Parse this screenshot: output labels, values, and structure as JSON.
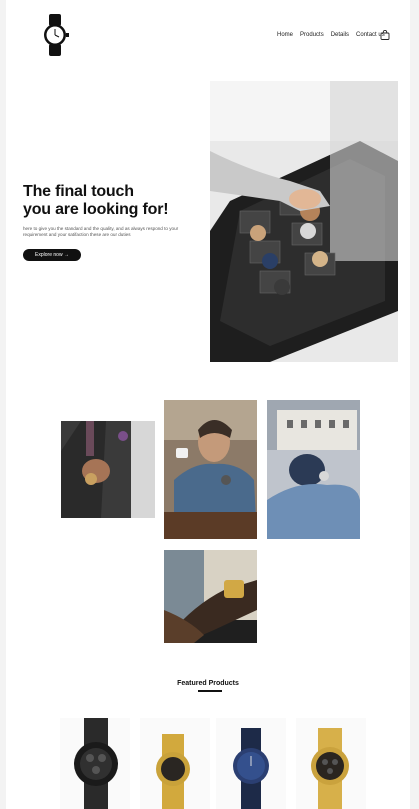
{
  "header": {
    "logo_icon": "wristwatch-logo-icon",
    "nav": [
      "Home",
      "Products",
      "Details",
      "Contact us"
    ],
    "cart_icon": "shopping-bag-icon"
  },
  "hero": {
    "title_line1": "The final touch",
    "title_line2": "you are looking for!",
    "text": "here to give you the standard and the quality, and as always respond to your requirement and your satifaction these are our duties",
    "button": "Explore now →"
  },
  "featured": {
    "title": "Featured Products"
  }
}
